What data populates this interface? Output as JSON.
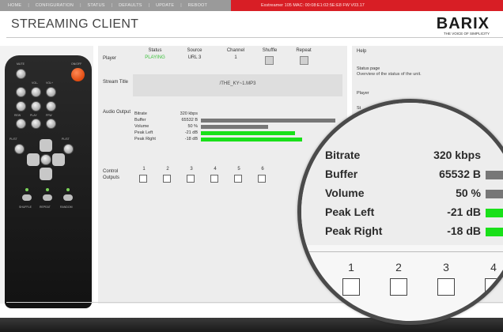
{
  "nav": {
    "items": [
      "HOME",
      "CONFIGURATION",
      "STATUS",
      "DEFAULTS",
      "UPDATE",
      "REBOOT"
    ],
    "device_info": "Exstreamer 105   MAC: 00:08:E1:02:5E:E8   FW V03.17"
  },
  "header": {
    "title": "STREAMING CLIENT",
    "logo_text": "BARIX",
    "logo_tagline": "THE VOICE OF SIMPLICITY"
  },
  "player": {
    "label": "Player",
    "headers": [
      "Status",
      "Source",
      "Channel",
      "Shuffle",
      "Repeat"
    ],
    "status": "PLAYING",
    "source": "URL 3",
    "channel": "1"
  },
  "stream": {
    "label": "Stream Title",
    "title": "/THE_KY~1.MP3"
  },
  "audio": {
    "label": "Audio Output",
    "rows": [
      {
        "name": "Bitrate",
        "value": "320 kbps",
        "bar": null
      },
      {
        "name": "Buffer",
        "value": "65532 B",
        "bar": 1.0
      },
      {
        "name": "Volume",
        "value": "50 %",
        "bar": 0.5
      },
      {
        "name": "Peak Left",
        "value": "-21 dB",
        "bar": 0.7
      },
      {
        "name": "Peak Right",
        "value": "-18 dB",
        "bar": 0.75
      }
    ]
  },
  "control": {
    "label": "Control Outputs",
    "numbers": [
      "1",
      "2",
      "3",
      "4",
      "5",
      "6"
    ]
  },
  "help": {
    "title": "Help",
    "status_heading": "Status page",
    "status_text": "Overview of the status of the unit.",
    "player_heading": "Player",
    "stream_heading": "St"
  },
  "magnifier": {
    "numbers": [
      "1",
      "2",
      "3",
      "4"
    ]
  },
  "remote": {
    "power_label": "ON/OFF",
    "buttons": [
      "MUTE",
      "VOL-",
      "VOL+",
      "REW",
      "PLAY",
      "FFW",
      "PL/ST",
      "PLAY",
      "PL/ST"
    ],
    "bottom_labels": [
      "SHUFFLE",
      "REPEAT",
      "RANDOM"
    ]
  },
  "colors": {
    "nav_bg": "#9a9a9a",
    "info_bg": "#d81e25",
    "status_playing": "#3cc13c",
    "meter_gray": "#777777",
    "meter_green": "#19e019"
  }
}
